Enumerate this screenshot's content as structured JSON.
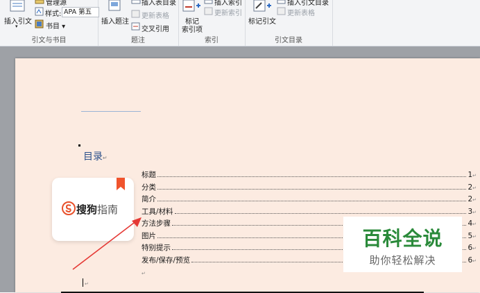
{
  "ribbon": {
    "groups": {
      "citations": {
        "label": "引文与书目",
        "insert_citation": "插入引文",
        "insert_citation_arrow": "▾",
        "manage_sources": "管理源",
        "style_label": "样式:",
        "style_value": "APA 第五",
        "bibliography": "书目 ▾"
      },
      "captions": {
        "label": "题注",
        "insert_caption": "插入题注",
        "insert_table_of_figures": "插入表目录",
        "update_table": "更新表格",
        "cross_reference": "交叉引用"
      },
      "index": {
        "label": "索引",
        "mark_entry_line1": "标记",
        "mark_entry_line2": "索引项",
        "insert_index": "插入索引",
        "update_index": "更新索引"
      },
      "toa": {
        "label": "引文目录",
        "mark_citation": "标记引文",
        "insert_toa": "插入引文目录",
        "update_table": "更新表格"
      }
    }
  },
  "document": {
    "toc_heading": "目录",
    "para_mark": "↵",
    "toc_entries": [
      {
        "title": "标题",
        "page": "1"
      },
      {
        "title": "分类",
        "page": "2"
      },
      {
        "title": "简介",
        "page": "2"
      },
      {
        "title": "工具/材料",
        "page": "3"
      },
      {
        "title": "方法步骤",
        "page": "4"
      },
      {
        "title": "图片",
        "page": "5"
      },
      {
        "title": "特别提示",
        "page": "6"
      },
      {
        "title": "发布/保存/预览",
        "page": "6"
      }
    ]
  },
  "overlays": {
    "logo_text_main": "搜狗",
    "logo_text_sub": "指南",
    "watermark_title": "百科全说",
    "watermark_sub": "助你轻松解决"
  },
  "colors": {
    "page_bg": "#fcebe1",
    "heading": "#2a4f8a",
    "arrow": "#e53935",
    "watermark_green": "#2a8a3a"
  }
}
